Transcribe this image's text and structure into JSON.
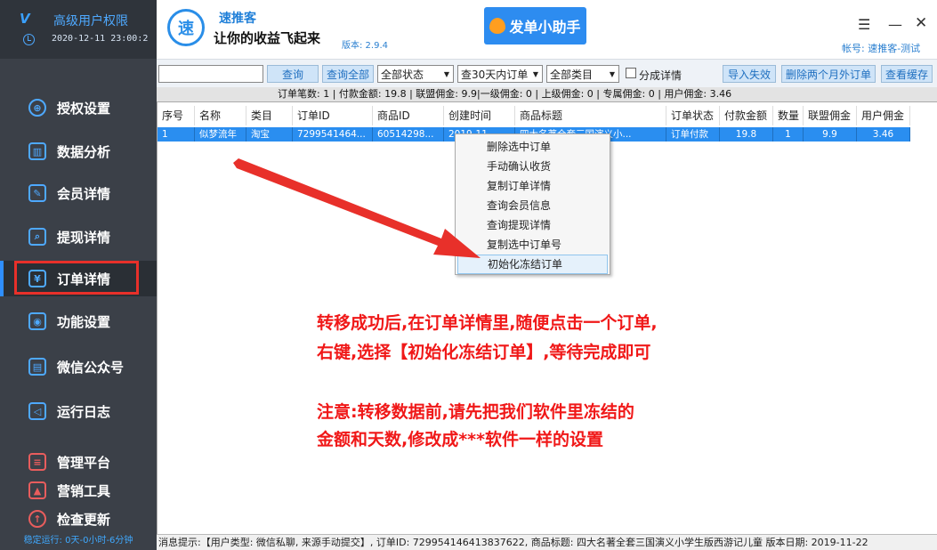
{
  "sidebar": {
    "logo": "V",
    "title": "高级用户权限",
    "datetime": "2020-12-11 23:00:2",
    "items": [
      {
        "label": "授权设置",
        "icon": "globe-icon"
      },
      {
        "label": "数据分析",
        "icon": "chart-icon"
      },
      {
        "label": "会员详情",
        "icon": "edit-icon"
      },
      {
        "label": "提现详情",
        "icon": "search-grid-icon"
      },
      {
        "label": "订单详情",
        "icon": "yen-receipt-icon"
      },
      {
        "label": "功能设置",
        "icon": "wechat-icon"
      },
      {
        "label": "微信公众号",
        "icon": "printer-icon"
      },
      {
        "label": "运行日志",
        "icon": "speaker-icon"
      },
      {
        "label": "管理平台",
        "icon": "platform-icon"
      },
      {
        "label": "营销工具",
        "icon": "marketing-chart-icon"
      },
      {
        "label": "检查更新",
        "icon": "update-icon"
      }
    ],
    "runtime": "稳定运行: 0天-0小时-6分钟"
  },
  "header": {
    "logo_char": "速",
    "app_name": "速推客",
    "slogan": "让你的收益飞起来",
    "version": "版本: 2.9.4",
    "promo_button": "发单小助手",
    "account": "帐号: 速推客-测试",
    "menu_glyph": "☰",
    "minimize_glyph": "—",
    "close_glyph": "✕"
  },
  "toolbar": {
    "search_placeholder": "",
    "query_label": "查询",
    "query_all_label": "查询全部",
    "status_select": "全部状态",
    "range_select": "查30天内订单",
    "category_select": "全部类目",
    "split_detail_label": "分成详情",
    "import_failed_label": "导入失效",
    "delete_old_label": "删除两个月外订单",
    "view_cache_label": "查看缓存"
  },
  "summary": "订单笔数: 1 | 付款金额: 19.8 | 联盟佣金: 9.9|一级佣金: 0 | 上级佣金: 0 | 专属佣金: 0 | 用户佣金: 3.46",
  "table": {
    "columns": [
      "序号",
      "名称",
      "类目",
      "订单ID",
      "商品ID",
      "创建时间",
      "商品标题",
      "订单状态",
      "付款金额",
      "数量",
      "联盟佣金",
      "用户佣金"
    ],
    "rows": [
      [
        "1",
        "似梦流年",
        "淘宝",
        "7299541464...",
        "60514298...",
        "2019-11-...",
        "四大名著全套三国演义小...",
        "订单付款",
        "19.8",
        "1",
        "9.9",
        "3.46"
      ]
    ]
  },
  "context_menu": {
    "items": [
      "删除选中订单",
      "手动确认收货",
      "复制订单详情",
      "查询会员信息",
      "查询提现详情",
      "复制选中订单号",
      "初始化冻结订单"
    ],
    "selected_index": 6
  },
  "annotation": {
    "line1": "转移成功后,在订单详情里,随便点击一个订单,",
    "line2": "右键,选择【初始化冻结订单】,等待完成即可",
    "line3": "注意:转移数据前,请先把我们软件里冻结的",
    "line4": "金额和天数,修改成***软件一样的设置"
  },
  "statusbar": "消息提示:【用户类型: 微信私聊, 来源手动提交】, 订单ID: 729954146413837622, 商品标题: 四大名著全套三国演义小学生版西游记儿童 版本日期: 2019-11-22",
  "colors": {
    "sidebar_bg": "#3b4048",
    "accent_blue": "#2a8ef0",
    "highlight_red": "#e8302a",
    "annotation_red": "#f01818"
  }
}
